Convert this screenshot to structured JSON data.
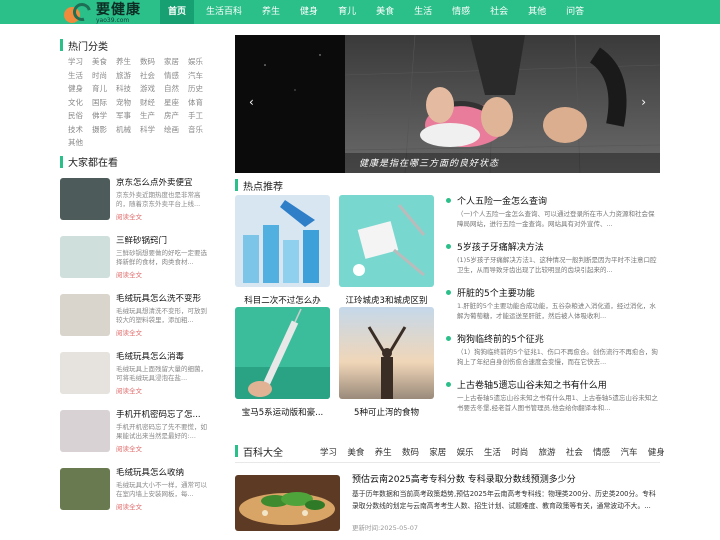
{
  "site": {
    "logo_text": "要健康",
    "logo_domain": "yao39.com"
  },
  "nav": [
    "首页",
    "生活百科",
    "养生",
    "健身",
    "育儿",
    "美食",
    "生活",
    "情感",
    "社会",
    "其他",
    "问答"
  ],
  "sidebar": {
    "hot_title": "热门分类",
    "categories": [
      "学习",
      "美食",
      "养生",
      "数码",
      "家居",
      "娱乐",
      "生活",
      "时尚",
      "旅游",
      "社会",
      "情感",
      "汽车",
      "健身",
      "育儿",
      "科技",
      "游戏",
      "自然",
      "历史",
      "文化",
      "国际",
      "宠物",
      "财经",
      "星座",
      "体育",
      "民俗",
      "佛学",
      "军事",
      "生产",
      "房产",
      "手工",
      "技术",
      "摄影",
      "机械",
      "科学",
      "绘画",
      "音乐",
      "其他"
    ],
    "watch_title": "大家都在看",
    "more_label": "阅读全文",
    "watch_items": [
      {
        "title": "京东怎么点外卖便宜",
        "desc": "京东外卖近期热度也是非常高的，随着京东外卖平台上线..."
      },
      {
        "title": "三鲜砂锅窍门",
        "desc": "三鲜砂锅想要做的好吃一定要选择新鲜的食材，肉类食材..."
      },
      {
        "title": "毛绒玩具怎么洗不变形",
        "desc": "毛绒玩具想清洗不变形，可放到较大的塑料袋里，添加粗..."
      },
      {
        "title": "毛绒玩具怎么消毒",
        "desc": "毛绒玩具上面残留大量的细菌，可将毛绒玩具浸泡在盐..."
      },
      {
        "title": "手机开机密码忘了怎...",
        "desc": "手机开机密码忘了先不要慌，如果能试出来当然是最好的:..."
      },
      {
        "title": "毛绒玩具怎么收纳",
        "desc": "毛绒玩具大小不一样，通常可以在室内墙上安装网板，每..."
      }
    ]
  },
  "banner": {
    "caption": "健康是指在哪三方面的良好状态",
    "prev_icon": "‹",
    "next_icon": "›"
  },
  "hot": {
    "title": "热点推荐",
    "cards": [
      "科目二次不过怎么办",
      "江玲城虎3和城虎区别",
      "宝马5系运动版和豪...",
      "5种可止泻的食物"
    ],
    "news": [
      {
        "title": "个人五险一金怎么查询",
        "desc": "（一)个人五险一金怎么查询、可以通过登录所在市人力资源和社会保障局网站，进行五险一金查询。网站具有对外宣传、..."
      },
      {
        "title": "5岁孩子牙痛解决方法",
        "desc": "(1)5岁孩子牙痛解决方法1、这种情况一般判断是因为平时不注意口腔卫生，从而导致牙齿出现了比较明显的齿块引起来的..."
      },
      {
        "title": "肝脏的5个主要功能",
        "desc": "1.肝脏的5个主要功能合成功能，五谷杂粮进入消化道，经过消化，水解为葡萄糖，才能运送至肝脏，然后被人体吸收利..."
      },
      {
        "title": "狗狗临终前的5个征兆",
        "desc": "（1）狗狗临终前的5个征兆1、伤口不再愈合。创伤流行不再愈合，狗狗上了年纪自身创伤愈合速度会变慢，而在它快去..."
      },
      {
        "title": "上古卷轴5遗忘山谷未知之书有什么用",
        "desc": "一上古卷轴5遗忘山谷未知之书有什么用1、上古卷轴5遗忘山谷未知之书要去冬堡,经老首人图书管理员,他会给你翻译本和..."
      }
    ]
  },
  "baike": {
    "title": "百科大全",
    "tabs": [
      "学习",
      "美食",
      "养生",
      "数码",
      "家居",
      "娱乐",
      "生活",
      "时尚",
      "旅游",
      "社会",
      "情感",
      "汽车",
      "健身"
    ],
    "article": {
      "title": "预估云南2025高考专科分数 专科录取分数线预测多少分",
      "desc": "基于历年数据和当前高考政策趋势,预估2025年云南高考专科线：物理类200分、历史类200分。专科录取分数线的划定与云南高考考生人数、招生计划、试题难度、教育政策等有关，通常波动不大。...",
      "time": "更新时间:2025-05-07"
    }
  }
}
